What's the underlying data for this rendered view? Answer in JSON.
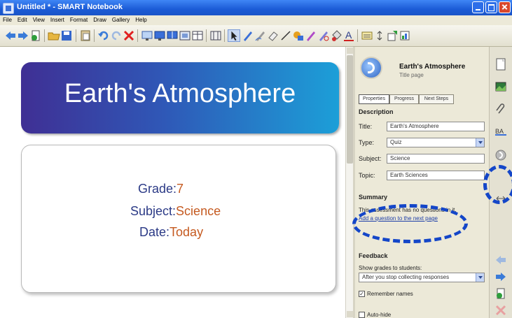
{
  "window": {
    "title": "Untitled * - SMART Notebook"
  },
  "menu": [
    "File",
    "Edit",
    "View",
    "Insert",
    "Format",
    "Draw",
    "Gallery",
    "Help"
  ],
  "toolbar": {
    "icons": [
      "back-arrow-icon",
      "forward-arrow-icon",
      "add-page-icon",
      "open-folder-icon",
      "save-icon",
      "paste-icon",
      "undo-icon",
      "redo-icon",
      "delete-icon",
      "screen-shade-icon",
      "full-screen-icon",
      "dual-page-icon",
      "capture-icon",
      "table-icon",
      "select-icon",
      "pen-icon",
      "creative-pen-icon",
      "eraser-icon",
      "line-icon",
      "shapes-icon",
      "magic-pen-icon",
      "shape-recognition-icon",
      "fill-icon",
      "text-icon",
      "properties-icon",
      "more-icon",
      "add-ons-icon",
      "measure-icon"
    ]
  },
  "slide": {
    "title": "Earth's Atmosphere",
    "grade_label": "Grade:",
    "grade_value": "7",
    "subject_label": "Subject:",
    "subject_value": "Science",
    "date_label": "Date:",
    "date_value": "Today"
  },
  "panel": {
    "title": "Earth's Atmosphere",
    "subtitle": "Title page",
    "tabs": [
      "Properties",
      "Progress",
      "Next Steps"
    ],
    "description_heading": "Description",
    "fields": {
      "title_label": "Title:",
      "title_value": "Earth's Atmosphere",
      "type_label": "Type:",
      "type_value": "Quiz",
      "subject_label": "Subject:",
      "subject_value": "Science",
      "topic_label": "Topic:",
      "topic_value": "Earth Sciences"
    },
    "summary_heading": "Summary",
    "summary_text": "This assessment has no questions in it.",
    "summary_link": "Add a question to the next page",
    "feedback_heading": "Feedback",
    "show_grades_label": "Show grades to students:",
    "show_grades_value": "After you stop collecting responses",
    "remember_names_label": "Remember names",
    "autohide_label": "Auto-hide"
  },
  "sidebar": {
    "icons": [
      "page-sorter-icon",
      "gallery-icon",
      "attachments-icon",
      "properties-abc-icon",
      "response-icon",
      "resize-arrows-icon",
      "previous-page-icon",
      "next-page-icon",
      "add-page-icon",
      "delete-page-icon"
    ]
  }
}
